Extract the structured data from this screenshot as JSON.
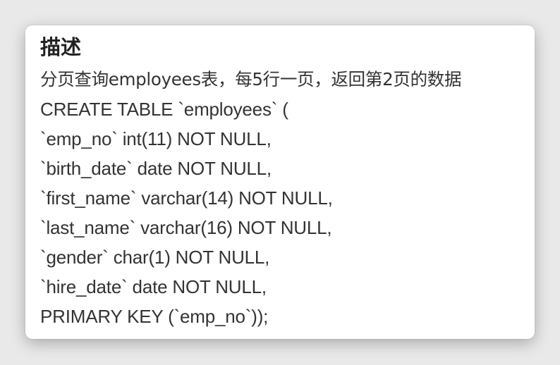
{
  "panel": {
    "title": "描述",
    "description": "分页查询employees表，每5行一页，返回第2页的数据",
    "code_lines": [
      "CREATE TABLE `employees` (",
      "`emp_no` int(11) NOT NULL,",
      "`birth_date` date NOT NULL,",
      "`first_name` varchar(14) NOT NULL,",
      "`last_name` varchar(16) NOT NULL,",
      "`gender` char(1) NOT NULL,",
      "`hire_date` date NOT NULL,",
      "PRIMARY KEY (`emp_no`));"
    ]
  }
}
